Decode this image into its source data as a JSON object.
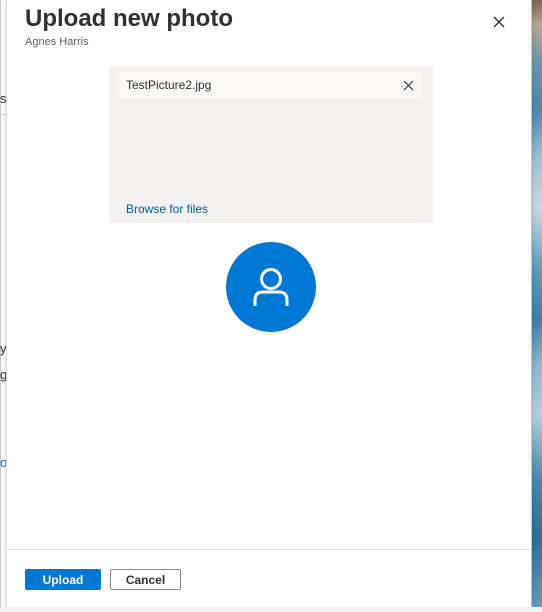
{
  "dialog": {
    "title": "Upload new photo",
    "subtitle": "Agnes Harris",
    "close_icon": "close-icon"
  },
  "dropzone": {
    "file_name": "TestPicture2.jpg",
    "remove_icon": "close-icon",
    "browse_label": "Browse for files"
  },
  "avatar": {
    "icon": "person-icon",
    "color": "#0078d4"
  },
  "footer": {
    "upload_label": "Upload",
    "cancel_label": "Cancel"
  },
  "background_page": {
    "fragments": [
      "s",
      "y",
      "g",
      "o"
    ]
  },
  "colors": {
    "accent": "#0078d4",
    "link": "#005a9e",
    "dropzone_bg": "#f3f2f1"
  }
}
